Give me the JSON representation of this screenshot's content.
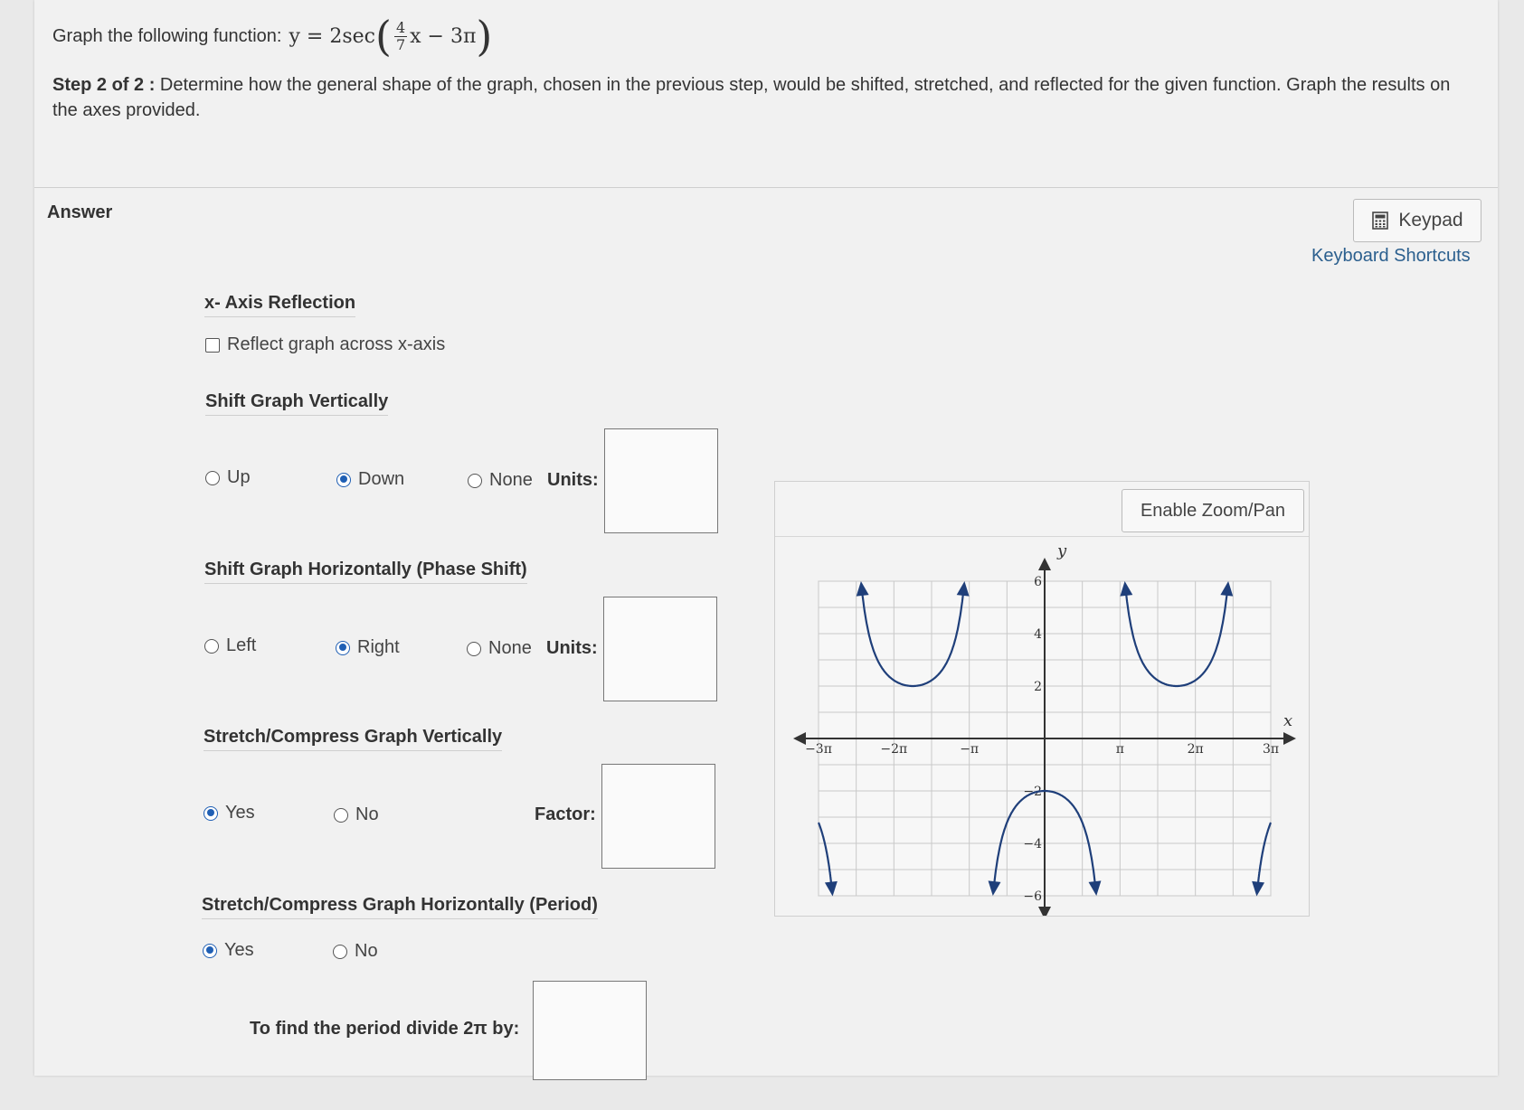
{
  "question": {
    "prompt": "Graph the following function:",
    "function_prefix": "y = 2sec",
    "frac_num": "4",
    "frac_den": "7",
    "function_suffix": "x − 3π",
    "step_label": "Step 2 of 2 :",
    "step_text": "Determine how the general shape of the graph, chosen in the previous step, would be shifted, stretched, and reflected for the given function. Graph the results on the axes provided."
  },
  "answer": {
    "label": "Answer",
    "keypad_label": "Keypad",
    "keyboard_shortcuts": "Keyboard Shortcuts"
  },
  "reflection": {
    "title": "x- Axis Reflection",
    "checkbox_label": "Reflect graph across x-axis",
    "checked": false
  },
  "vertical_shift": {
    "title": "Shift Graph Vertically",
    "options": [
      "Up",
      "Down",
      "None"
    ],
    "selected": "Down",
    "units_label": "Units:",
    "units_value": ""
  },
  "horizontal_shift": {
    "title": "Shift Graph Horizontally (Phase Shift)",
    "options": [
      "Left",
      "Right",
      "None"
    ],
    "selected": "Right",
    "units_label": "Units:",
    "units_value": ""
  },
  "vertical_stretch": {
    "title": "Stretch/Compress Graph Vertically",
    "options": [
      "Yes",
      "No"
    ],
    "selected": "Yes",
    "factor_label": "Factor:",
    "factor_value": ""
  },
  "horizontal_stretch": {
    "title": "Stretch/Compress Graph Horizontally (Period)",
    "options": [
      "Yes",
      "No"
    ],
    "selected": "Yes",
    "period_label": "To find the period divide 2π by:",
    "period_value": ""
  },
  "graph": {
    "zoom_label": "Enable Zoom/Pan",
    "x_axis_label": "x",
    "y_axis_label": "y",
    "x_ticks": [
      "−3π",
      "−2π",
      "−π",
      "π",
      "2π",
      "3π"
    ],
    "y_ticks": [
      "6",
      "4",
      "2",
      "−2",
      "−4",
      "−6"
    ]
  },
  "colors": {
    "curve": "#1f3f7a",
    "radio_selected": "#1f5fb4",
    "link": "#2b5f8e"
  }
}
